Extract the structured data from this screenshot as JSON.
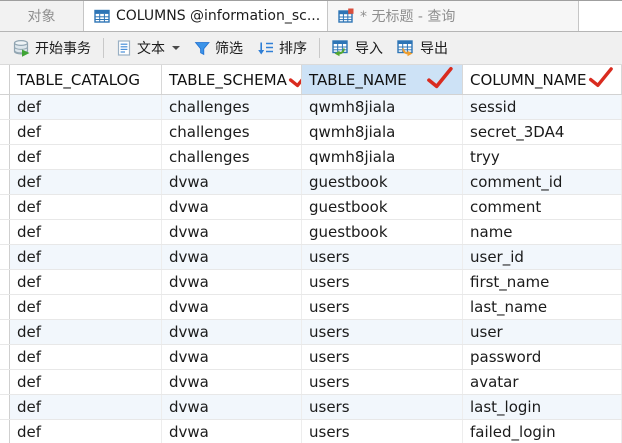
{
  "tabs": [
    {
      "label": "对象",
      "active": false
    },
    {
      "label": "COLUMNS @information_sc...",
      "active": true,
      "icon": "table-icon"
    },
    {
      "label": "* 无标题 - 查询",
      "active": false,
      "icon": "query-icon"
    }
  ],
  "toolbar": {
    "begin_transaction": "开始事务",
    "text": "文本",
    "filter": "筛选",
    "sort": "排序",
    "import": "导入",
    "export": "导出"
  },
  "grid": {
    "columns": [
      {
        "name": "TABLE_CATALOG",
        "checked": false,
        "selected": false
      },
      {
        "name": "TABLE_SCHEMA",
        "checked": true,
        "selected": false
      },
      {
        "name": "TABLE_NAME",
        "checked": true,
        "selected": true
      },
      {
        "name": "COLUMN_NAME",
        "checked": true,
        "selected": false
      }
    ],
    "rows": [
      [
        "def",
        "challenges",
        "qwmh8jiala",
        "sessid"
      ],
      [
        "def",
        "challenges",
        "qwmh8jiala",
        "secret_3DA4"
      ],
      [
        "def",
        "challenges",
        "qwmh8jiala",
        "tryy"
      ],
      [
        "def",
        "dvwa",
        "guestbook",
        "comment_id"
      ],
      [
        "def",
        "dvwa",
        "guestbook",
        "comment"
      ],
      [
        "def",
        "dvwa",
        "guestbook",
        "name"
      ],
      [
        "def",
        "dvwa",
        "users",
        "user_id"
      ],
      [
        "def",
        "dvwa",
        "users",
        "first_name"
      ],
      [
        "def",
        "dvwa",
        "users",
        "last_name"
      ],
      [
        "def",
        "dvwa",
        "users",
        "user"
      ],
      [
        "def",
        "dvwa",
        "users",
        "password"
      ],
      [
        "def",
        "dvwa",
        "users",
        "avatar"
      ],
      [
        "def",
        "dvwa",
        "users",
        "last_login"
      ],
      [
        "def",
        "dvwa",
        "users",
        "failed_login"
      ]
    ]
  },
  "colors": {
    "selected_header_bg": "#cde2f6",
    "striped_row_bg": "#f2f7fc",
    "check_red": "#d92b1f",
    "icon_blue": "#2e75b6",
    "accent_green": "#3fa435",
    "accent_orange": "#f09f2e",
    "toolbar_bg": "#f0f0f0"
  }
}
